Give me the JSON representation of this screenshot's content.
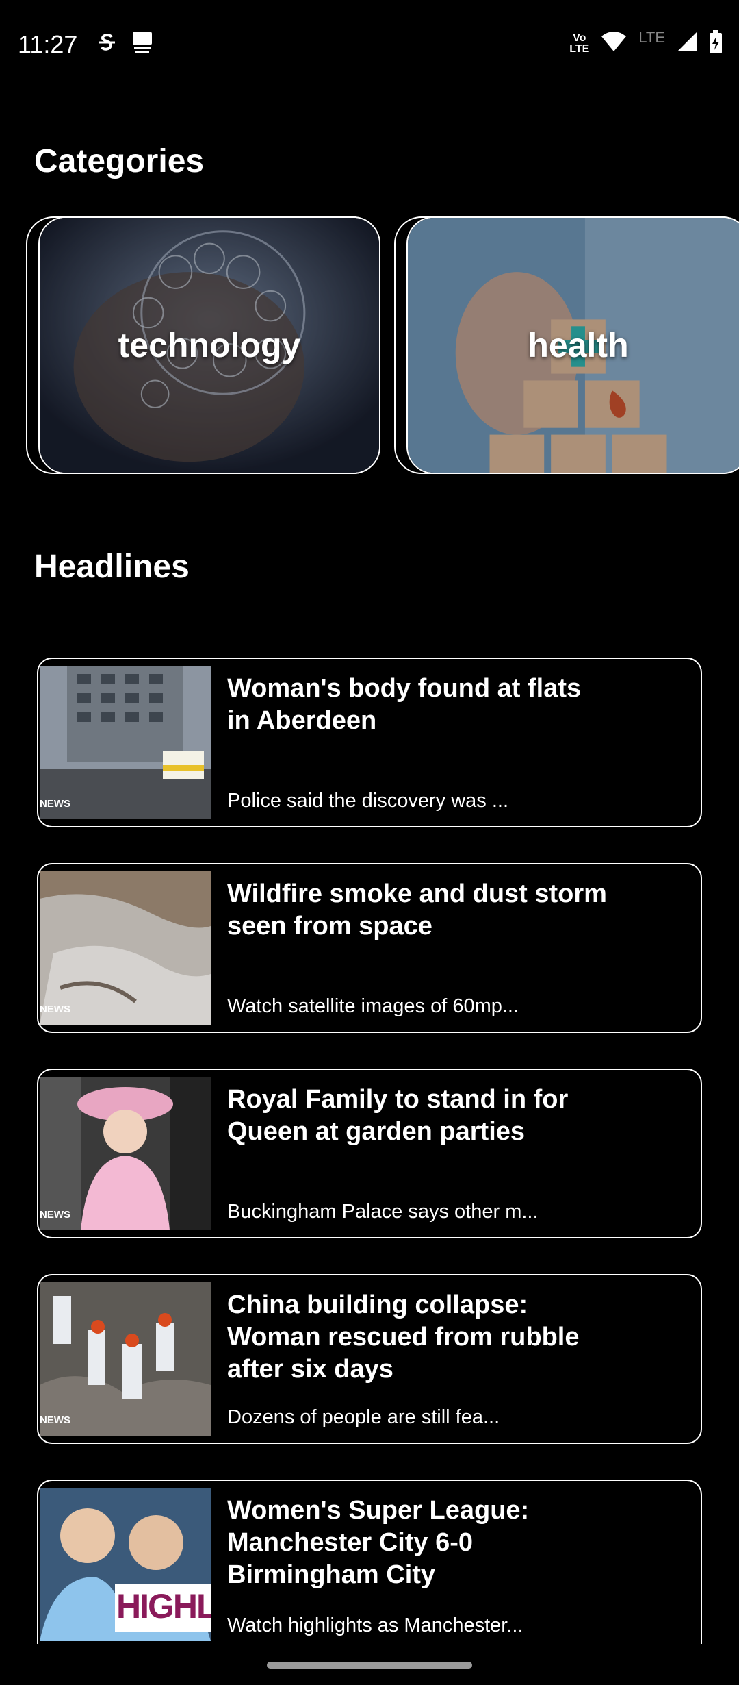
{
  "status_bar": {
    "time": "11:27",
    "volte_line1": "Vo",
    "volte_line2": "LTE",
    "lte_label": "LTE",
    "icons": [
      "s-logo-icon",
      "news-app-icon",
      "volte-icon",
      "wifi-icon",
      "signal-icon",
      "battery-charging-icon"
    ]
  },
  "sections": {
    "categories_title": "Categories",
    "headlines_title": "Headlines"
  },
  "categories": [
    {
      "label": "technology"
    },
    {
      "label": "health"
    }
  ],
  "headlines": [
    {
      "title": "Woman's body found at flats in Aberdeen",
      "description": "Police said the discovery was ...",
      "tag": "NEWS"
    },
    {
      "title": "Wildfire smoke and dust storm seen from space",
      "description": "Watch satellite images of 60mp...",
      "tag": "NEWS"
    },
    {
      "title": "Royal Family to stand in for Queen at garden parties",
      "description": "Buckingham Palace says other m...",
      "tag": "NEWS"
    },
    {
      "title": "China building collapse: Woman rescued from rubble after six days",
      "description": "Dozens of people are still fea...",
      "tag": "NEWS"
    },
    {
      "title": "Women's Super League: Manchester City 6-0 Birmingham City",
      "description": "Watch highlights as Manchester...",
      "tag": "HIGHLIG"
    }
  ],
  "colors": {
    "background": "#000000",
    "text": "#ffffff",
    "border": "#ffffff"
  }
}
